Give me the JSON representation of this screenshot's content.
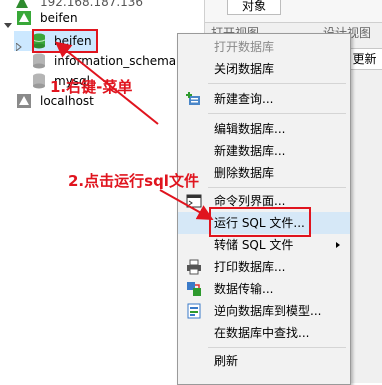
{
  "tree": {
    "top_connection": "192.168.187.136",
    "connection": "beifen",
    "selected_db": "beifen",
    "databases": [
      "information_schema",
      "mysql"
    ],
    "localhost": "localhost"
  },
  "right_panel": {
    "tab": "对象",
    "toolbar_left": "打开视图",
    "toolbar_right": "设计视图",
    "refresh": "更新"
  },
  "menu": {
    "items": [
      {
        "label": "打开数据库",
        "disabled": true
      },
      {
        "label": "关闭数据库",
        "disabled": false
      },
      {
        "label": "新建查询...",
        "disabled": false,
        "icon": "new-query-icon"
      },
      {
        "label": "编辑数据库...",
        "disabled": false
      },
      {
        "label": "新建数据库...",
        "disabled": false
      },
      {
        "label": "删除数据库",
        "disabled": false
      },
      {
        "label": "命令列界面...",
        "disabled": false,
        "icon": "console-icon"
      },
      {
        "label": "运行 SQL 文件...",
        "disabled": false,
        "highlighted": true
      },
      {
        "label": "转储 SQL 文件",
        "disabled": false,
        "submenu": true
      },
      {
        "label": "打印数据库...",
        "disabled": false,
        "icon": "print-icon"
      },
      {
        "label": "数据传输...",
        "disabled": false,
        "icon": "transfer-icon"
      },
      {
        "label": "逆向数据库到模型...",
        "disabled": false,
        "icon": "model-icon"
      },
      {
        "label": "在数据库中查找...",
        "disabled": false
      },
      {
        "label": "刷新",
        "disabled": false
      }
    ]
  },
  "annotations": {
    "step1": "1.右键-菜单",
    "step2": "2.点击运行sql文件"
  },
  "colors": {
    "annotation_red": "#e0141e",
    "db_green": "#3aa63a",
    "selection": "#cce8ff"
  }
}
